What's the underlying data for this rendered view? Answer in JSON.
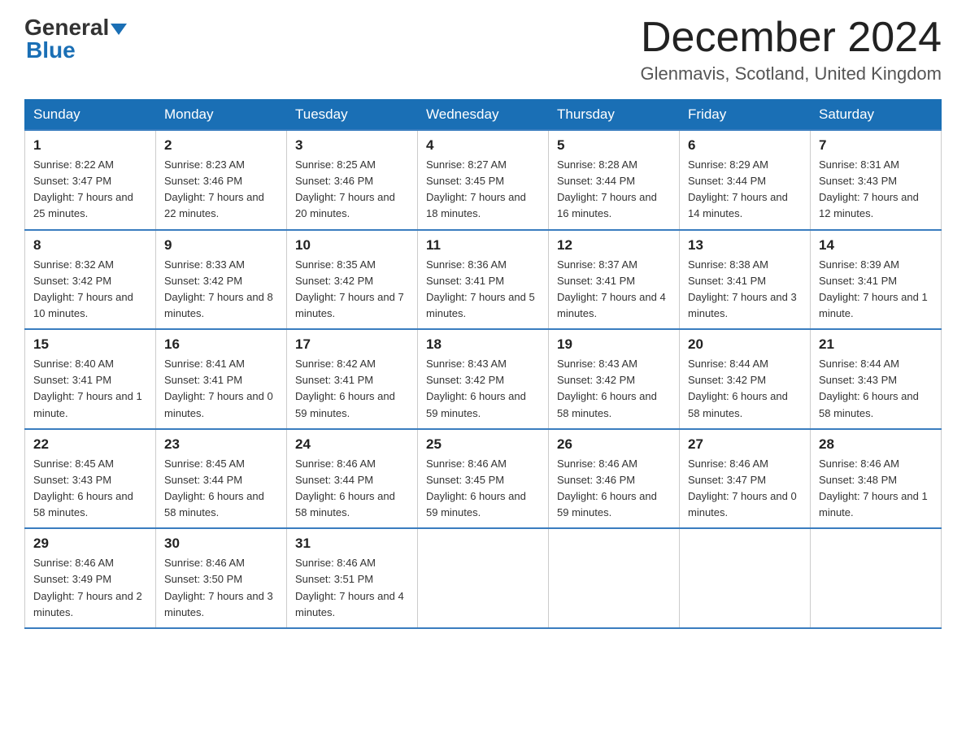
{
  "header": {
    "logo_general": "General",
    "logo_blue": "Blue",
    "month_title": "December 2024",
    "location": "Glenmavis, Scotland, United Kingdom"
  },
  "days_of_week": [
    "Sunday",
    "Monday",
    "Tuesday",
    "Wednesday",
    "Thursday",
    "Friday",
    "Saturday"
  ],
  "weeks": [
    [
      {
        "day": "1",
        "sunrise": "8:22 AM",
        "sunset": "3:47 PM",
        "daylight": "7 hours and 25 minutes."
      },
      {
        "day": "2",
        "sunrise": "8:23 AM",
        "sunset": "3:46 PM",
        "daylight": "7 hours and 22 minutes."
      },
      {
        "day": "3",
        "sunrise": "8:25 AM",
        "sunset": "3:46 PM",
        "daylight": "7 hours and 20 minutes."
      },
      {
        "day": "4",
        "sunrise": "8:27 AM",
        "sunset": "3:45 PM",
        "daylight": "7 hours and 18 minutes."
      },
      {
        "day": "5",
        "sunrise": "8:28 AM",
        "sunset": "3:44 PM",
        "daylight": "7 hours and 16 minutes."
      },
      {
        "day": "6",
        "sunrise": "8:29 AM",
        "sunset": "3:44 PM",
        "daylight": "7 hours and 14 minutes."
      },
      {
        "day": "7",
        "sunrise": "8:31 AM",
        "sunset": "3:43 PM",
        "daylight": "7 hours and 12 minutes."
      }
    ],
    [
      {
        "day": "8",
        "sunrise": "8:32 AM",
        "sunset": "3:42 PM",
        "daylight": "7 hours and 10 minutes."
      },
      {
        "day": "9",
        "sunrise": "8:33 AM",
        "sunset": "3:42 PM",
        "daylight": "7 hours and 8 minutes."
      },
      {
        "day": "10",
        "sunrise": "8:35 AM",
        "sunset": "3:42 PM",
        "daylight": "7 hours and 7 minutes."
      },
      {
        "day": "11",
        "sunrise": "8:36 AM",
        "sunset": "3:41 PM",
        "daylight": "7 hours and 5 minutes."
      },
      {
        "day": "12",
        "sunrise": "8:37 AM",
        "sunset": "3:41 PM",
        "daylight": "7 hours and 4 minutes."
      },
      {
        "day": "13",
        "sunrise": "8:38 AM",
        "sunset": "3:41 PM",
        "daylight": "7 hours and 3 minutes."
      },
      {
        "day": "14",
        "sunrise": "8:39 AM",
        "sunset": "3:41 PM",
        "daylight": "7 hours and 1 minute."
      }
    ],
    [
      {
        "day": "15",
        "sunrise": "8:40 AM",
        "sunset": "3:41 PM",
        "daylight": "7 hours and 1 minute."
      },
      {
        "day": "16",
        "sunrise": "8:41 AM",
        "sunset": "3:41 PM",
        "daylight": "7 hours and 0 minutes."
      },
      {
        "day": "17",
        "sunrise": "8:42 AM",
        "sunset": "3:41 PM",
        "daylight": "6 hours and 59 minutes."
      },
      {
        "day": "18",
        "sunrise": "8:43 AM",
        "sunset": "3:42 PM",
        "daylight": "6 hours and 59 minutes."
      },
      {
        "day": "19",
        "sunrise": "8:43 AM",
        "sunset": "3:42 PM",
        "daylight": "6 hours and 58 minutes."
      },
      {
        "day": "20",
        "sunrise": "8:44 AM",
        "sunset": "3:42 PM",
        "daylight": "6 hours and 58 minutes."
      },
      {
        "day": "21",
        "sunrise": "8:44 AM",
        "sunset": "3:43 PM",
        "daylight": "6 hours and 58 minutes."
      }
    ],
    [
      {
        "day": "22",
        "sunrise": "8:45 AM",
        "sunset": "3:43 PM",
        "daylight": "6 hours and 58 minutes."
      },
      {
        "day": "23",
        "sunrise": "8:45 AM",
        "sunset": "3:44 PM",
        "daylight": "6 hours and 58 minutes."
      },
      {
        "day": "24",
        "sunrise": "8:46 AM",
        "sunset": "3:44 PM",
        "daylight": "6 hours and 58 minutes."
      },
      {
        "day": "25",
        "sunrise": "8:46 AM",
        "sunset": "3:45 PM",
        "daylight": "6 hours and 59 minutes."
      },
      {
        "day": "26",
        "sunrise": "8:46 AM",
        "sunset": "3:46 PM",
        "daylight": "6 hours and 59 minutes."
      },
      {
        "day": "27",
        "sunrise": "8:46 AM",
        "sunset": "3:47 PM",
        "daylight": "7 hours and 0 minutes."
      },
      {
        "day": "28",
        "sunrise": "8:46 AM",
        "sunset": "3:48 PM",
        "daylight": "7 hours and 1 minute."
      }
    ],
    [
      {
        "day": "29",
        "sunrise": "8:46 AM",
        "sunset": "3:49 PM",
        "daylight": "7 hours and 2 minutes."
      },
      {
        "day": "30",
        "sunrise": "8:46 AM",
        "sunset": "3:50 PM",
        "daylight": "7 hours and 3 minutes."
      },
      {
        "day": "31",
        "sunrise": "8:46 AM",
        "sunset": "3:51 PM",
        "daylight": "7 hours and 4 minutes."
      },
      null,
      null,
      null,
      null
    ]
  ],
  "labels": {
    "sunrise": "Sunrise:",
    "sunset": "Sunset:",
    "daylight": "Daylight:"
  }
}
